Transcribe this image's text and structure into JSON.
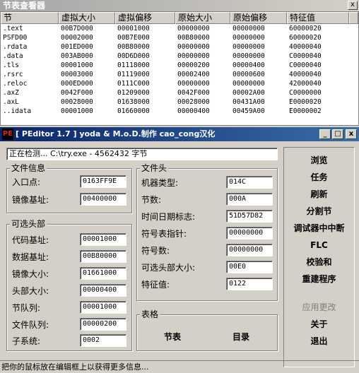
{
  "section_window": {
    "title": "节表查看器",
    "close_label": "x",
    "columns": [
      "节",
      "虚拟大小",
      "虚拟偏移",
      "原始大小",
      "原始偏移",
      "特征值"
    ],
    "rows": [
      [
        ".text",
        "00B7D000",
        "00001000",
        "00000000",
        "00000000",
        "60000020"
      ],
      [
        "PSFD00",
        "00002000",
        "00B7E000",
        "00B80000",
        "00000000",
        "60000020"
      ],
      [
        ".rdata",
        "001ED000",
        "00B80000",
        "00000000",
        "00000000",
        "40000040"
      ],
      [
        ".data",
        "003AB000",
        "00D6D000",
        "00000000",
        "00000000",
        "C0000040"
      ],
      [
        ".tls",
        "00001000",
        "01118000",
        "00000200",
        "00000400",
        "C0000040"
      ],
      [
        ".rsrc",
        "00003000",
        "01119000",
        "00002400",
        "00000600",
        "40000040"
      ],
      [
        ".reloc",
        "000ED000",
        "0111C000",
        "00000000",
        "00000000",
        "42000040"
      ],
      [
        ".axZ",
        "0042F000",
        "01209000",
        "0042F000",
        "00002A00",
        "C0000000"
      ],
      [
        ".axL",
        "00028000",
        "01638000",
        "00028000",
        "00431A00",
        "E0000020"
      ],
      [
        "..idata",
        "00001000",
        "01660000",
        "00000400",
        "00459A00",
        "E0000002"
      ]
    ]
  },
  "peditor": {
    "logo_text": "PE",
    "title": "[ PEditor 1.7 ] yoda & M.o.D.制作 cao_cong汉化",
    "min_label": "_",
    "max_label": "□",
    "close_label": "x",
    "path_field": "正在检测... C:\\try.exe - 4562432 字节",
    "file_info": {
      "title": "文件信息",
      "entry_label": "入口点:",
      "entry_value": "0163FF9E",
      "image_base_label": "镜像基址:",
      "image_base_value": "00400000"
    },
    "optional_header": {
      "title": "可选头部",
      "fields": [
        {
          "label": "代码基址:",
          "value": "00001000"
        },
        {
          "label": "数据基址:",
          "value": "00B80000"
        },
        {
          "label": "镜像大小:",
          "value": "01661000"
        },
        {
          "label": "头部大小:",
          "value": "00000400"
        },
        {
          "label": "节队列:",
          "value": "00001000"
        },
        {
          "label": "文件队列:",
          "value": "00000200"
        },
        {
          "label": "子系统:",
          "value": "0002"
        }
      ]
    },
    "file_header": {
      "title": "文件头",
      "fields": [
        {
          "label": "机器类型:",
          "value": "014C"
        },
        {
          "label": "节数:",
          "value": "000A"
        },
        {
          "label": "时间日期标志:",
          "value": "51D57D82"
        },
        {
          "label": "符号表指针:",
          "value": "00000000"
        },
        {
          "label": "符号数:",
          "value": "00000000"
        },
        {
          "label": "可选头部大小:",
          "value": "00E0"
        },
        {
          "label": "特征值:",
          "value": "0122"
        }
      ]
    },
    "tables": {
      "title": "表格",
      "sections_button": "节表",
      "directory_button": "目录"
    },
    "side_buttons": [
      "浏览",
      "任务",
      "刷新",
      "分割节",
      "调试器中中断",
      "FLC",
      "校验和",
      "重建程序"
    ],
    "apply_button": "应用更改",
    "about_button": "关于",
    "exit_button": "退出",
    "status_text": "把你的鼠标放在编辑框上以获得更多信息..."
  }
}
